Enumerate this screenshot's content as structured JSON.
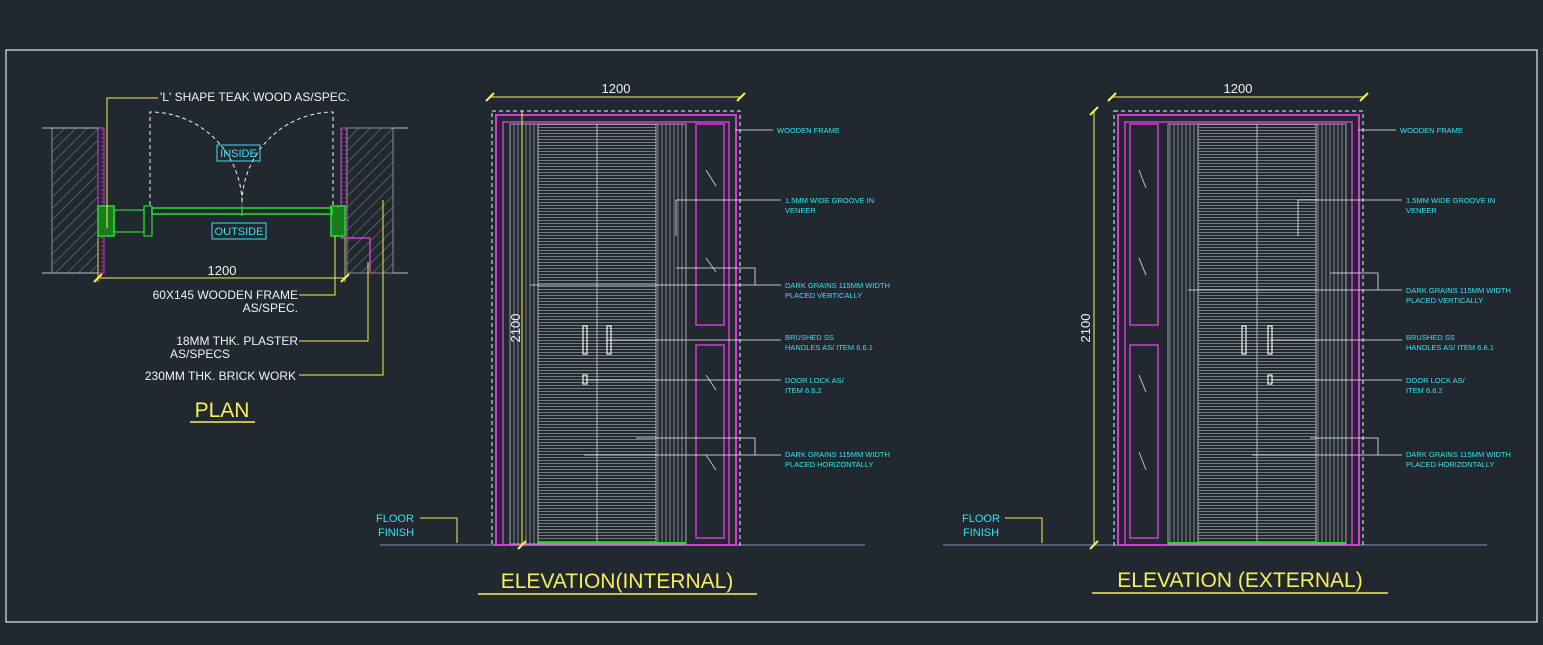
{
  "plan": {
    "title": "PLAN",
    "labels": {
      "l_shape": "'L' SHAPE TEAK WOOD AS/SPEC.",
      "inside": "INSIDE",
      "outside": "OUTSIDE",
      "width": "1200",
      "frame_1": "60X145 WOODEN FRAME",
      "frame_2": "AS/SPEC.",
      "plaster_1": "18MM THK. PLASTER",
      "plaster_2": "AS/SPECS",
      "brick": "230MM THK. BRICK WORK"
    }
  },
  "elevation_internal": {
    "title": "ELEVATION(INTERNAL)",
    "width": "1200",
    "height": "2100",
    "floor_1": "FLOOR",
    "floor_2": "FINISH",
    "notes": {
      "frame": "WOODEN FRAME",
      "groove_1": "1.5MM WIDE GROOVE IN",
      "groove_2": "VENEER",
      "vert_1": "DARK GRAINS 115MM WIDTH",
      "vert_2": "PLACED VERTICALLY",
      "handle_1": "BRUSHED SS",
      "handle_2": "HANDLES AS/ ITEM 6.6.1",
      "lock_1": "DOOR LOCK AS/",
      "lock_2": "ITEM 6.6.2",
      "hor_1": "DARK GRAINS 115MM WIDTH",
      "hor_2": "PLACED HORIZONTALLY"
    }
  },
  "elevation_external": {
    "title": "ELEVATION (EXTERNAL)",
    "width": "1200",
    "height": "2100",
    "floor_1": "FLOOR",
    "floor_2": "FINISH",
    "notes": {
      "frame": "WOODEN FRAME",
      "groove_1": "1.5MM WIDE GROOVE IN",
      "groove_2": "VENEER",
      "vert_1": "DARK GRAINS 115MM WIDTH",
      "vert_2": "PLACED VERTICALLY",
      "handle_1": "BRUSHED SS",
      "handle_2": "HANDLES AS/ ITEM 6.6.1",
      "lock_1": "DOOR LOCK AS/",
      "lock_2": "ITEM 6.6.2",
      "hor_1": "DARK GRAINS 115MM WIDTH",
      "hor_2": "PLACED HORIZONTALLY"
    }
  },
  "colors": {
    "background": "#212830",
    "magenta": "#d43ad6",
    "cyan": "#39e0ef",
    "yellow": "#f6ef55",
    "green": "#22e02a",
    "white": "#f2f2f2"
  }
}
